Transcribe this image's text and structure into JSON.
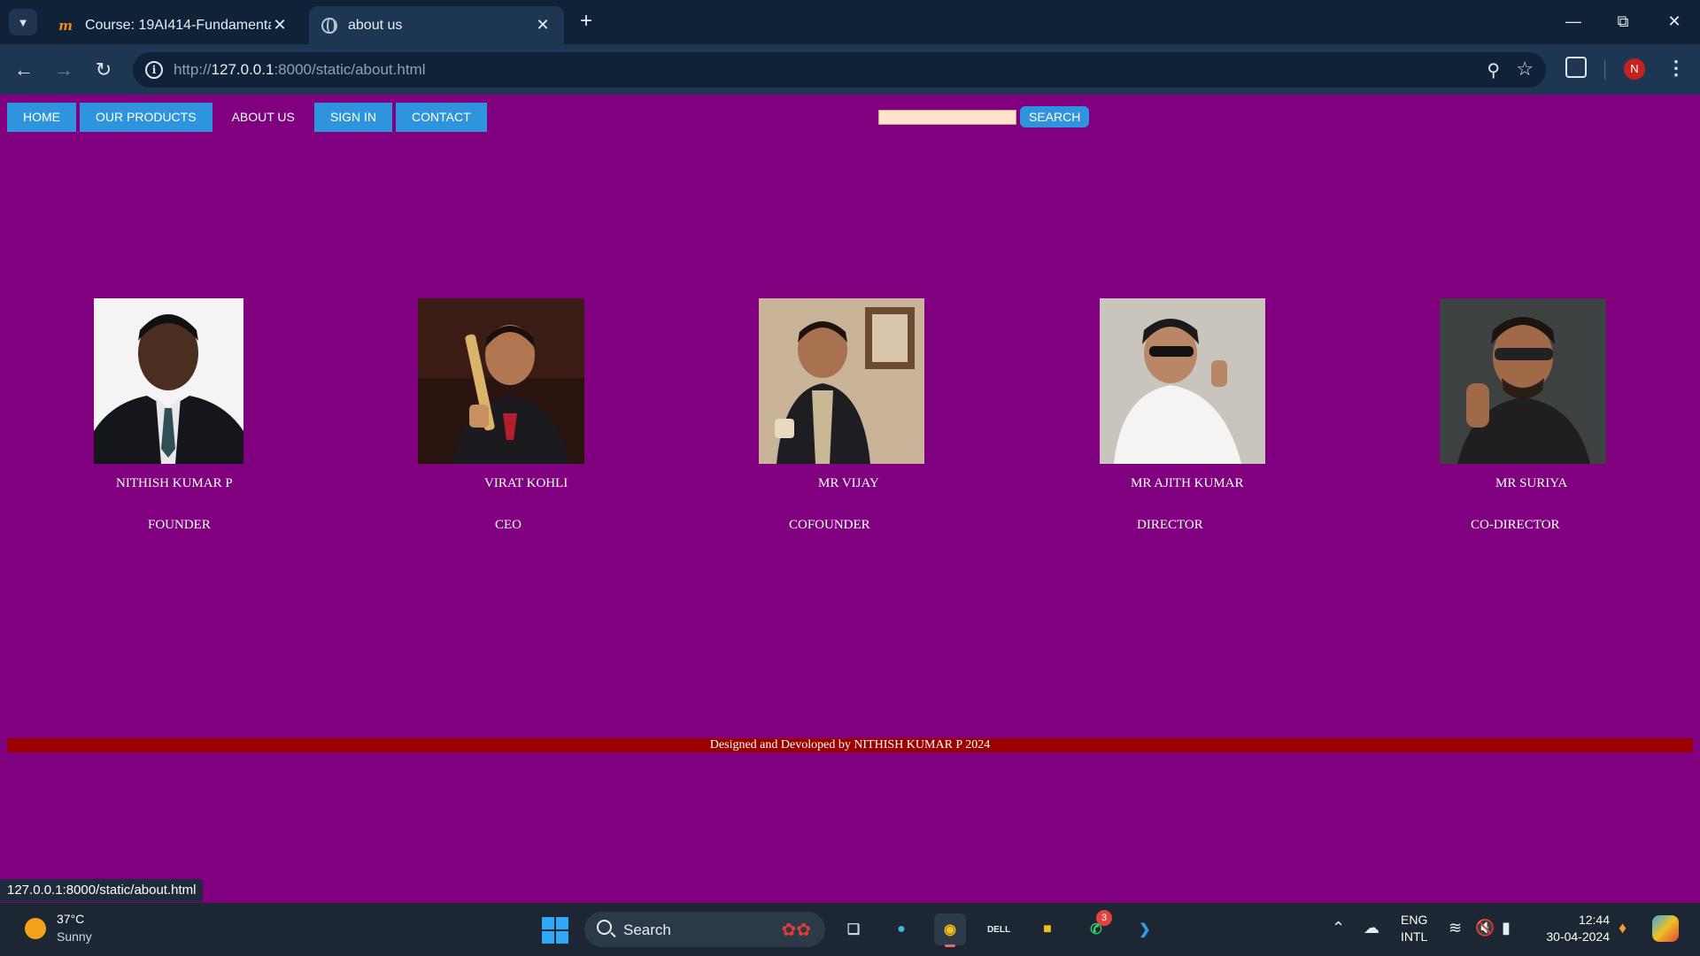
{
  "browser": {
    "tabs": [
      {
        "title": "Course: 19AI414-Fundamentals",
        "active": false,
        "icon": "moodle-icon"
      },
      {
        "title": "about us",
        "active": true,
        "icon": "globe-icon"
      }
    ],
    "url_prefix": "http://",
    "url_host": "127.0.0.1",
    "url_path": ":8000/static/about.html",
    "profile_initial": "N",
    "status_url": "127.0.0.1:8000/static/about.html"
  },
  "site": {
    "nav": {
      "home": "HOME",
      "products": "OUR PRODUCTS",
      "about": "ABOUT US",
      "signin": "SIGN IN",
      "contact": "CONTACT"
    },
    "search": {
      "value": "",
      "button": "SEARCH"
    },
    "team": [
      {
        "name": "NITHISH KUMAR P",
        "role": "FOUNDER"
      },
      {
        "name": "VIRAT KOHLI",
        "role": "CEO"
      },
      {
        "name": "MR VIJAY",
        "role": "COFOUNDER"
      },
      {
        "name": "MR AJITH KUMAR",
        "role": "DIRECTOR"
      },
      {
        "name": "MR SURIYA",
        "role": "CO-DIRECTOR"
      }
    ],
    "footer": "Designed and Devoloped by NITHISH KUMAR P 2024",
    "colors": {
      "background": "#800080",
      "nav_button": "#2f94de",
      "footer_bar": "#9b0000",
      "search_field": "#fde2cc"
    }
  },
  "taskbar": {
    "weather_temp": "37°C",
    "weather_condition": "Sunny",
    "search_label": "Search",
    "whatsapp_badge": "3",
    "lang_line1": "ENG",
    "lang_line2": "INTL",
    "time": "12:44",
    "date": "30-04-2024"
  }
}
